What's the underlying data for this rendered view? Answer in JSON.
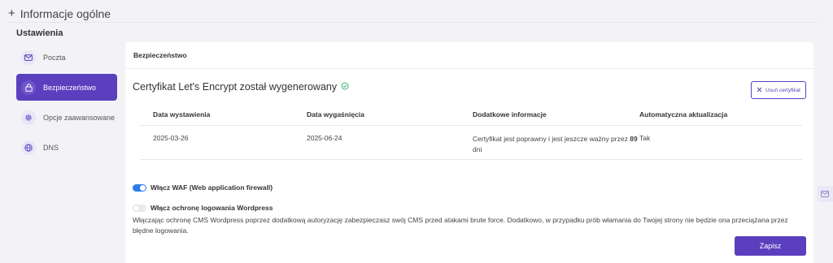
{
  "section": {
    "plus": "+",
    "title": "Informacje ogólne"
  },
  "settings_title": "Ustawienia",
  "sidebar": {
    "items": [
      {
        "label": "Poczta",
        "icon": "mail-icon",
        "active": false
      },
      {
        "label": "Bezpieczeństwo",
        "icon": "lock-icon",
        "active": true
      },
      {
        "label": "Opcje zaawansowane",
        "icon": "gear-icon",
        "active": false
      },
      {
        "label": "DNS",
        "icon": "globe-icon",
        "active": false
      }
    ]
  },
  "panel": {
    "header": "Bezpieczeństwo",
    "cert_title": "Certyfikat Let's Encrypt został wygenerowany",
    "remove_button": "Usuń certyfikat",
    "table": {
      "headers": [
        "Data wystawienia",
        "Data wygaśnięcia",
        "Dodatkowe informacje",
        "Automatyczna aktualizacja"
      ],
      "row": {
        "issued": "2025-03-26",
        "expires": "2025-06-24",
        "info_prefix": "Certyfikat jest poprawny i jest jeszcze ważny przez ",
        "info_days": "89",
        "info_suffix": " dni",
        "auto_update": "Tak"
      }
    },
    "waf_toggle": {
      "label": "Włącz WAF (Web application firewall)",
      "enabled": true
    },
    "wp_toggle": {
      "label": "Włącz ochronę logowania Wordpress",
      "enabled": false
    },
    "description": "Włączając ochronę CMS Wordpress poprzez dodatkową autoryzację zabezpieczasz swój CMS przed atakami brute force. Dodatkowo, w przypadku prób włamania do Twojej strony nie będzie ona przeciążana przez błędne logowania.",
    "save_button": "Zapisz"
  },
  "colors": {
    "accent": "#5a3fbf",
    "toggle_on": "#2b7de9",
    "success": "#3bb273"
  }
}
